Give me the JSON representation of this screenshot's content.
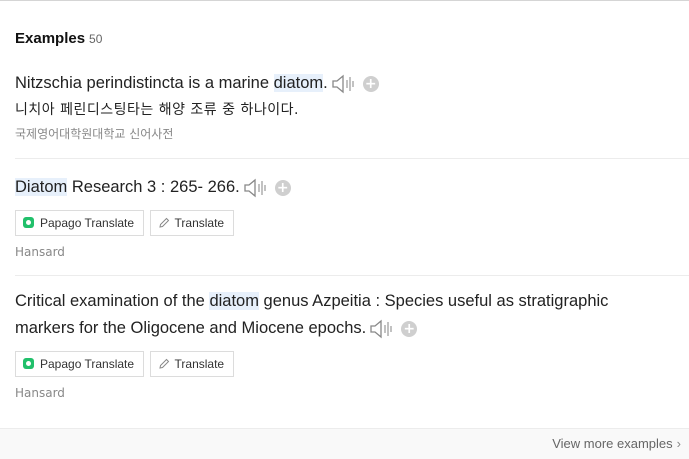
{
  "header": {
    "title": "Examples",
    "count": "50"
  },
  "examples": [
    {
      "pre": "Nitzschia perindistincta is a marine ",
      "hl": "diatom",
      "post": ".",
      "translation": "니치아 페린디스팅타는 해양 조류 중 하나이다.",
      "source": "국제영어대학원대학교 신어사전"
    },
    {
      "pre": "",
      "hl": "Diatom",
      "post": " Research 3 : 265- 266.",
      "papago_label": "Papago Translate",
      "translate_label": "Translate",
      "source": "Hansard"
    },
    {
      "pre": "Critical examination of the ",
      "hl": "diatom",
      "post": " genus Azpeitia : Species useful as stratigraphic markers for the Oligocene and Miocene epochs.",
      "papago_label": "Papago Translate",
      "translate_label": "Translate",
      "source": "Hansard"
    }
  ],
  "footer": {
    "more_label": "View more examples",
    "chevron": "›"
  },
  "icons": {
    "speaker": "speaker-icon",
    "plus": "add-to-wordbook-icon",
    "papago": "papago-logo-icon",
    "pen": "pen-icon"
  },
  "colors": {
    "highlight": "#e7f0fb",
    "papago": "#21c06b"
  }
}
